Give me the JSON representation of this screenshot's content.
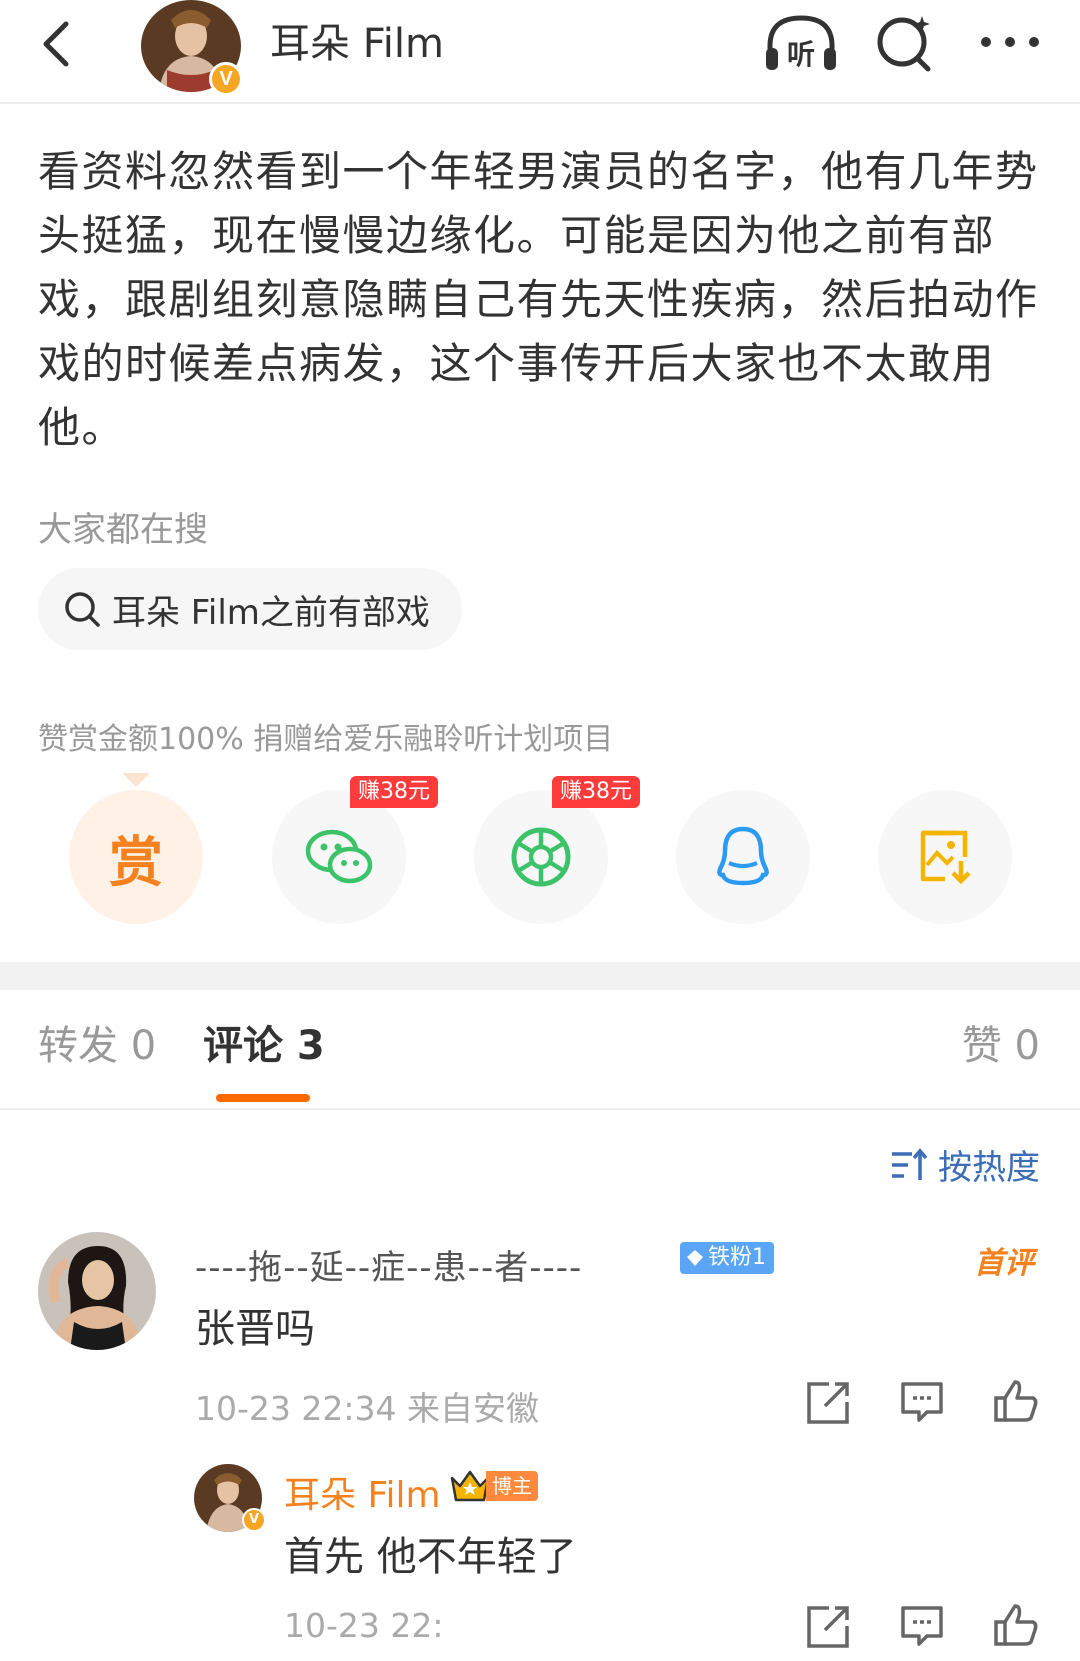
{
  "header": {
    "title": "耳朵 Film",
    "verified_badge": "V",
    "icons": [
      "back-arrow-icon",
      "listen-icon",
      "search-icon",
      "more-icon"
    ],
    "listen_label": "听"
  },
  "post": {
    "text": "看资料忽然看到一个年轻男演员的名字，他有几年势头挺猛，现在慢慢边缘化。可能是因为他之前有部戏，跟剧组刻意隐瞒自己有先天性疾病，然后拍动作戏的时候差点病发，这个事传开后大家也不太敢用他。"
  },
  "search": {
    "label": "大家都在搜",
    "chip_text": "耳朵 Film之前有部戏"
  },
  "reward": {
    "note": "赞赏金额100% 捐赠给爱乐融聆听计划项目",
    "button_char": "赏"
  },
  "share": {
    "earn_badge_1": "赚38元",
    "earn_badge_2": "赚38元",
    "icons": [
      "reward-icon",
      "wechat-icon",
      "moments-icon",
      "qq-icon",
      "save-image-icon"
    ]
  },
  "tabs": {
    "forward": "转发 0",
    "comment": "评论 3",
    "like": "赞 0"
  },
  "sort": {
    "label": "按热度"
  },
  "comments": [
    {
      "name": "----拖--延--症--患--者----",
      "badge": "铁粉1",
      "tag": "首评",
      "text": "张晋吗",
      "meta": "10-23 22:34  来自安徽"
    },
    {
      "name": "耳朵 Film",
      "badge": "博主",
      "verified_badge": "V",
      "text": "首先 他不年轻了",
      "meta": "10-23 22:"
    }
  ],
  "colors": {
    "accent_orange": "#f5821f",
    "tab_underline": "#ff6a00",
    "link_blue": "#3c6db5",
    "earn_red": "#ff3b3b",
    "wechat_green": "#3dc26a",
    "qq_blue": "#2b9af3",
    "save_yellow": "#f5b400"
  }
}
